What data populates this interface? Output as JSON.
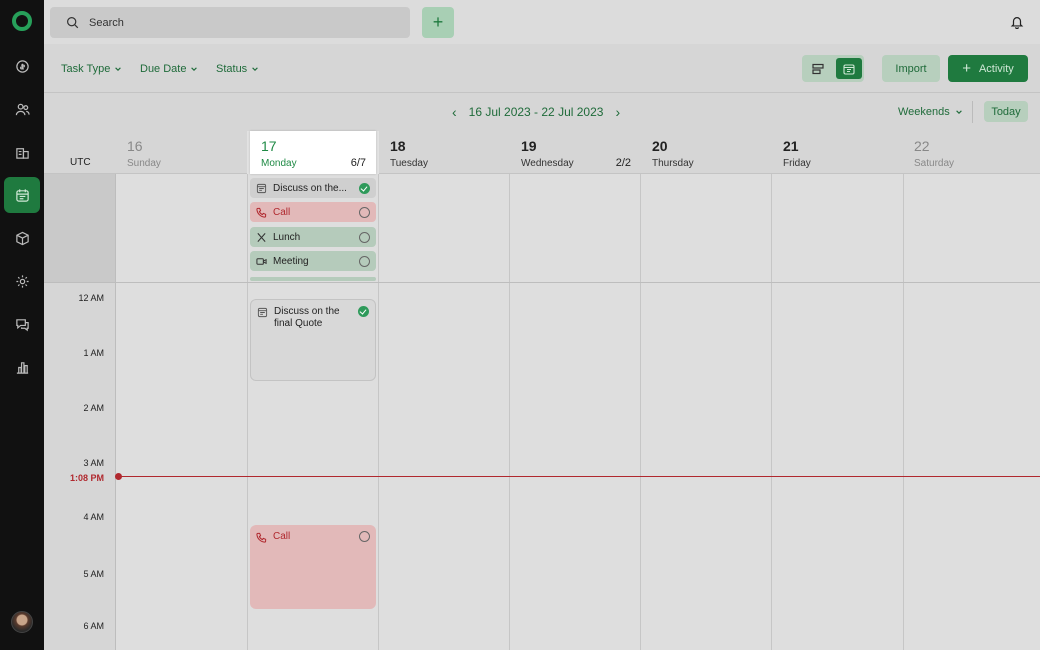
{
  "topbar": {
    "search_placeholder": "Search"
  },
  "filters": [
    {
      "label": "Task Type"
    },
    {
      "label": "Due Date"
    },
    {
      "label": "Status"
    }
  ],
  "actions": {
    "import_label": "Import",
    "activity_label": "Activity"
  },
  "calendar": {
    "range_label": "16 Jul 2023 - 22 Jul 2023",
    "weekends_label": "Weekends",
    "today_label": "Today",
    "timezone": "UTC",
    "days": [
      {
        "num": "16",
        "name": "Sunday",
        "count": ""
      },
      {
        "num": "17",
        "name": "Monday",
        "count": "6/7"
      },
      {
        "num": "18",
        "name": "Tuesday",
        "count": ""
      },
      {
        "num": "19",
        "name": "Wednesday",
        "count": "2/2"
      },
      {
        "num": "20",
        "name": "Thursday",
        "count": ""
      },
      {
        "num": "21",
        "name": "Friday",
        "count": ""
      },
      {
        "num": "22",
        "name": "Saturday",
        "count": ""
      }
    ],
    "time_labels": [
      "12 AM",
      "1 AM",
      "2 AM",
      "3 AM",
      "4 AM",
      "5 AM",
      "6 AM"
    ],
    "now_label": "1:08 PM",
    "allday_events": [
      {
        "title": "Discuss on the...",
        "type": "task",
        "done": true
      },
      {
        "title": "Call",
        "type": "call",
        "done": false
      },
      {
        "title": "Lunch",
        "type": "lunch",
        "done": false
      },
      {
        "title": "Meeting",
        "type": "meeting",
        "done": false
      }
    ],
    "timed_events": [
      {
        "title": "Discuss on the final Quote",
        "type": "task",
        "done": true
      },
      {
        "title": "Call",
        "type": "call",
        "done": false
      }
    ]
  },
  "colors": {
    "accent": "#1f7a3f",
    "now_line": "#b0282e"
  }
}
